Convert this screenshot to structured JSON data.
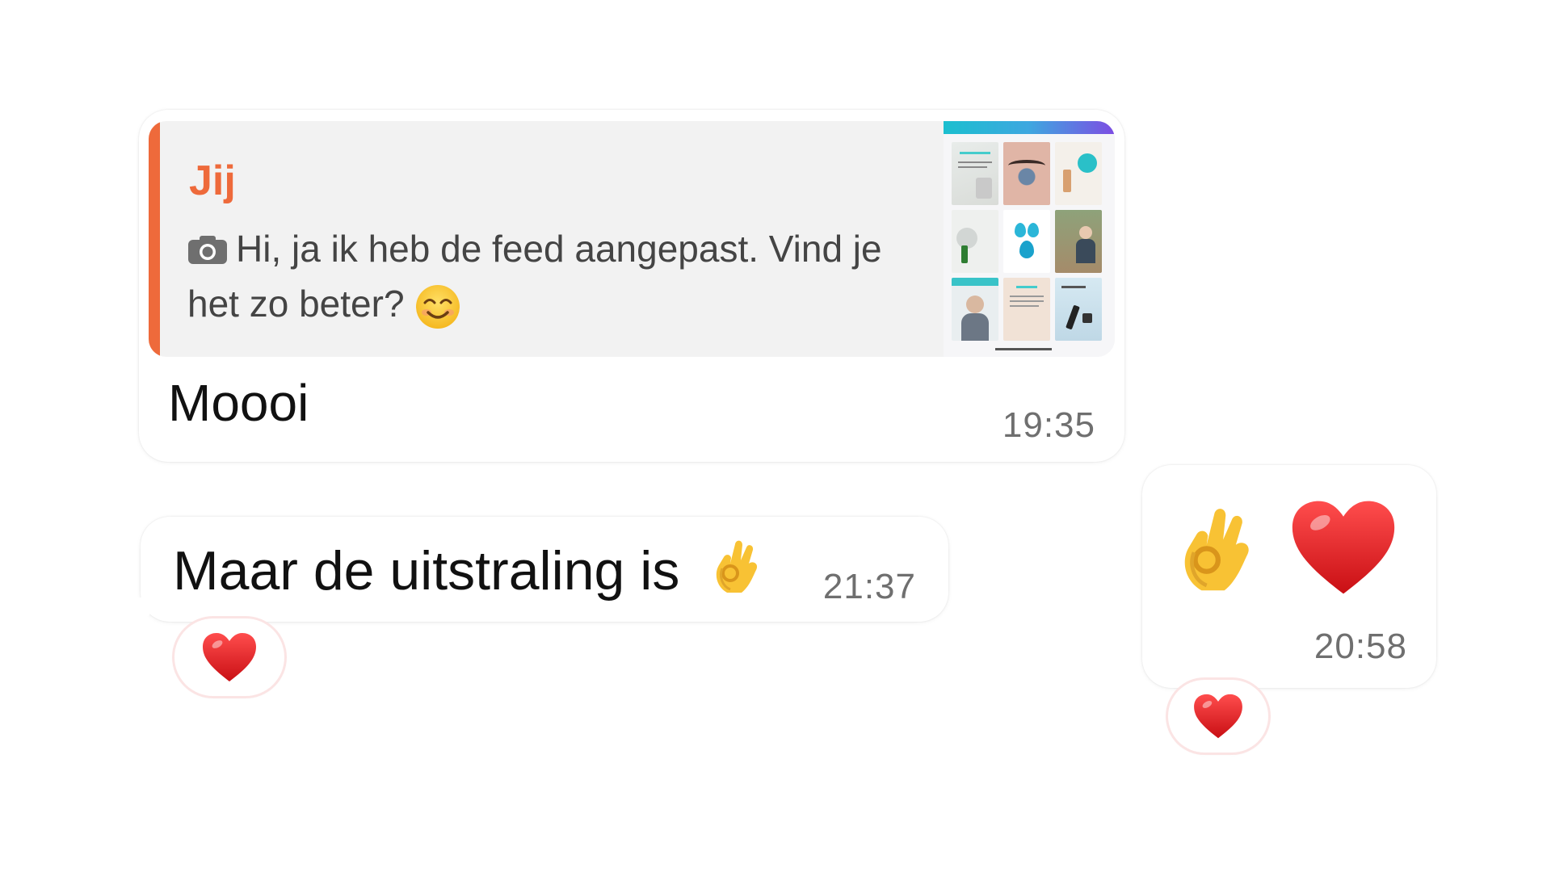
{
  "messages": [
    {
      "quote": {
        "author": "Jij",
        "text": "Hi, ja ik heb de feed aangepast. Vind je het zo beter?",
        "has_photo": true,
        "icon": "camera-icon",
        "emoji": "smiling-face-emoji"
      },
      "text": "Moooi",
      "time": "19:35",
      "direction": "incoming"
    },
    {
      "text": "Maar de uitstraling is",
      "emoji": "ok-hand-emoji",
      "time": "21:37",
      "direction": "incoming",
      "reaction": "red-heart-emoji"
    },
    {
      "emojis": [
        "ok-hand-emoji",
        "red-heart-emoji"
      ],
      "time": "20:58",
      "direction": "outgoing",
      "reaction": "red-heart-emoji"
    }
  ],
  "colors": {
    "quote_accent": "#ee6a3b",
    "quote_background": "#f2f2f2",
    "time_text": "#6f6f6f",
    "reaction_border": "#fbe4e4"
  }
}
